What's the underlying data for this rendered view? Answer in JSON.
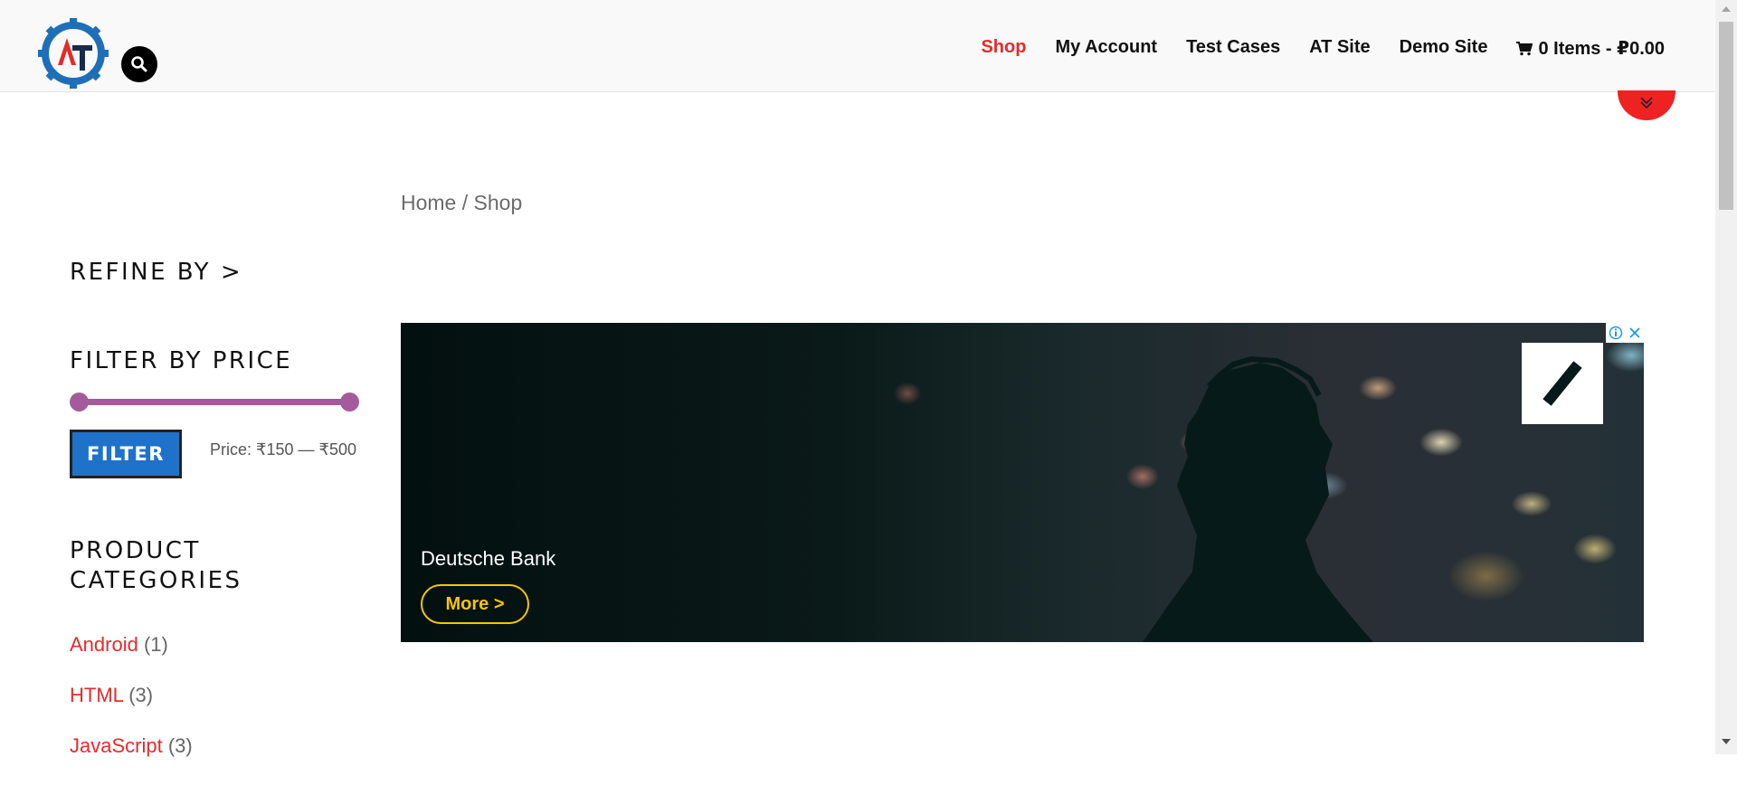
{
  "header": {
    "logo": {
      "icon": "gear-logo-icon",
      "letters": "AT"
    },
    "search": {
      "icon": "search-icon"
    },
    "nav": [
      {
        "label": "Shop",
        "active": true
      },
      {
        "label": "My Account"
      },
      {
        "label": "Test Cases"
      },
      {
        "label": "AT Site"
      },
      {
        "label": "Demo Site"
      }
    ],
    "cart": {
      "label": "0 Items - ₽0.00",
      "icon": "cart-icon"
    },
    "scroll_down": {
      "icon": "double-chevron-down-icon"
    }
  },
  "breadcrumb": {
    "home": "Home",
    "separator": " / ",
    "current": "Shop"
  },
  "sidebar": {
    "refine_title": "REFINE BY >",
    "filter_price": {
      "title": "FILTER BY PRICE",
      "button": "FILTER",
      "price_label": "Price: ₹150 — ₹500",
      "min": 150,
      "max": 500,
      "slider_color": "#a45b9b"
    },
    "categories": {
      "title": "PRODUCT CATEGORIES",
      "items": [
        {
          "name": "Android",
          "count": "(1)"
        },
        {
          "name": "HTML",
          "count": "(3)"
        },
        {
          "name": "JavaScript",
          "count": "(3)"
        }
      ]
    }
  },
  "ad": {
    "brand": "Deutsche Bank",
    "cta": "More >",
    "logo": "deutsche-bank-logo-icon",
    "controls": [
      "info-icon",
      "close-icon"
    ]
  },
  "colors": {
    "accent_red": "#e32b2b",
    "filter_button": "#1f72c9",
    "cta_yellow": "#f3c800"
  }
}
